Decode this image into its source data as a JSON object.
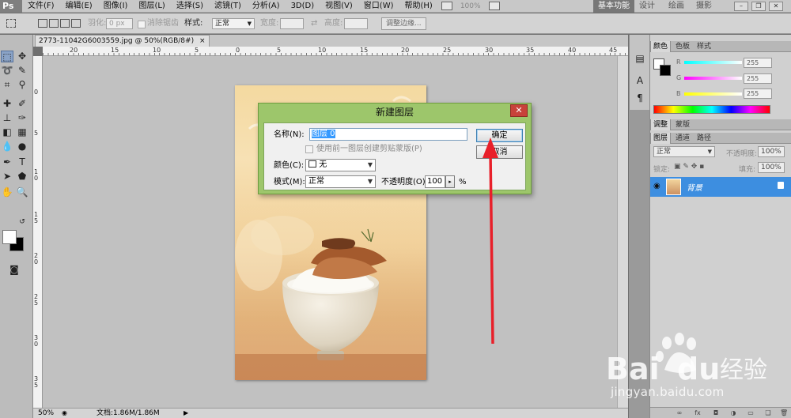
{
  "app": {
    "logo": "Ps",
    "menus": [
      "文件(F)",
      "编辑(E)",
      "图像(I)",
      "图层(L)",
      "选择(S)",
      "滤镜(T)",
      "分析(A)",
      "3D(D)",
      "视图(V)",
      "窗口(W)",
      "帮助(H)"
    ],
    "zoom_readout": "100%",
    "workspace_active": "基本功能",
    "workspaces": [
      "设计",
      "绘画",
      "摄影"
    ],
    "window_controls": [
      "minimize",
      "restore",
      "close"
    ]
  },
  "options_bar": {
    "feather_label": "羽化:",
    "feather_value": "0 px",
    "antialias_label": "消除锯齿",
    "style_label": "样式:",
    "style_value": "正常",
    "width_label": "宽度:",
    "height_label": "高度:",
    "refine_edge_button": "调整边缘..."
  },
  "document": {
    "tab_title": "2773-11042G6003559.jpg @ 50%(RGB/8#)",
    "tab_close": "×",
    "ruler_h_ticks": [
      "20",
      "15",
      "10",
      "5",
      "0",
      "5",
      "10",
      "15",
      "20",
      "25",
      "30",
      "35",
      "40",
      "45"
    ],
    "ruler_v_ticks": [
      "0",
      "5",
      "1\n0",
      "1\n5",
      "2\n0",
      "2\n5",
      "3\n0",
      "3\n5"
    ],
    "status_zoom": "50%",
    "status_doc": "文档:1.86M/1.86M"
  },
  "dialog": {
    "title": "新建图层",
    "close_symbol": "✕",
    "name_label": "名称(N):",
    "name_value": "图层 0",
    "clip_checkbox_label": "使用前一图层创建剪贴蒙版(P)",
    "color_label": "颜色(C):",
    "color_value": "无",
    "mode_label": "模式(M):",
    "mode_value": "正常",
    "opacity_label": "不透明度(O):",
    "opacity_value": "100",
    "opacity_unit": "%",
    "ok_button": "确定",
    "cancel_button": "取消"
  },
  "panels": {
    "color_tabs": [
      "颜色",
      "色板",
      "样式"
    ],
    "color_sliders": [
      {
        "label": "R",
        "value": "255"
      },
      {
        "label": "G",
        "value": "255"
      },
      {
        "label": "B",
        "value": "255"
      }
    ],
    "adjust_tabs": [
      "调整",
      "蒙版"
    ],
    "layers_tabs": [
      "图层",
      "通道",
      "路径"
    ],
    "blend_mode": "正常",
    "opacity_label": "不透明度:",
    "opacity_value": "100%",
    "lock_label": "锁定:",
    "fill_label": "填充:",
    "fill_value": "100%",
    "layer_name": "背景"
  },
  "watermark": {
    "brand": "Bai",
    "brand2": "du",
    "cn": "经验",
    "url": "jingyan.baidu.com"
  },
  "colors": {
    "accent_blue": "#3d8ee0",
    "dialog_green": "#9dc66b",
    "arrow_red": "#e8202a"
  }
}
